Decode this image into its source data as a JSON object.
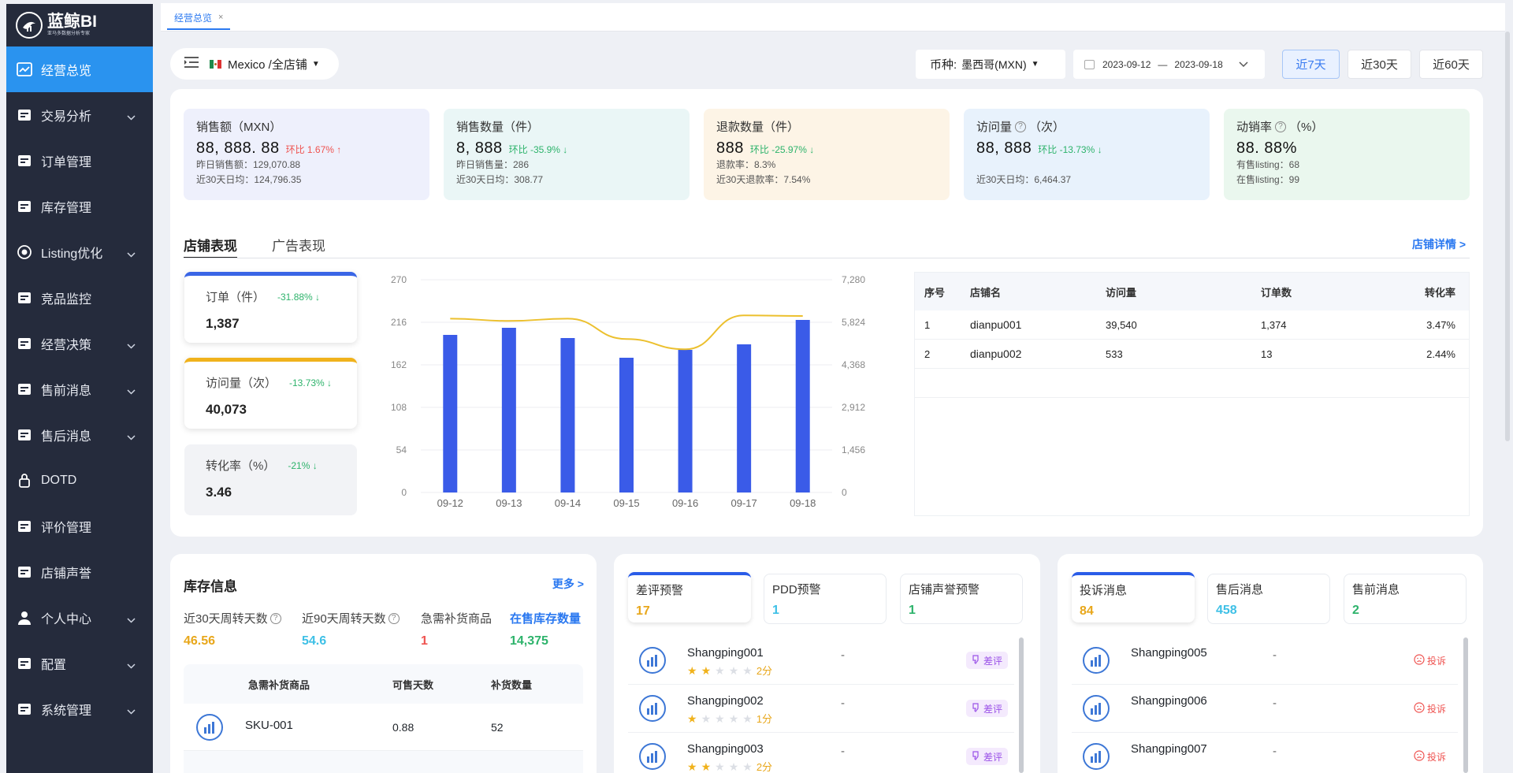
{
  "sidebar": {
    "logo_title": "蓝鲸BI",
    "logo_subtitle": "亚马多数据分析专家",
    "items": [
      {
        "label": "经营总览",
        "icon": "trend-chart-icon",
        "caret": false
      },
      {
        "label": "交易分析",
        "icon": "calendar-chart-icon",
        "caret": true
      },
      {
        "label": "订单管理",
        "icon": "order-icon",
        "caret": false
      },
      {
        "label": "库存管理",
        "icon": "inventory-icon",
        "caret": false
      },
      {
        "label": "Listing优化",
        "icon": "target-icon",
        "caret": true
      },
      {
        "label": "竞品监控",
        "icon": "lock-monitor-icon",
        "caret": false
      },
      {
        "label": "经营决策",
        "icon": "decision-icon",
        "caret": true
      },
      {
        "label": "售前消息",
        "icon": "message-icon",
        "caret": true
      },
      {
        "label": "售后消息",
        "icon": "after-sale-icon",
        "caret": true
      },
      {
        "label": "DOTD",
        "icon": "lock-icon",
        "caret": false
      },
      {
        "label": "评价管理",
        "icon": "review-icon",
        "caret": false
      },
      {
        "label": "店铺声誉",
        "icon": "reputation-icon",
        "caret": false
      },
      {
        "label": "个人中心",
        "icon": "user-icon",
        "caret": true
      },
      {
        "label": "配置",
        "icon": "config-icon",
        "caret": true
      },
      {
        "label": "系统管理",
        "icon": "system-icon",
        "caret": true
      }
    ]
  },
  "tabs": {
    "active_label": "经营总览",
    "close": "×"
  },
  "toolbar": {
    "store_selector": "Mexico /全店铺",
    "currency_label": "币种:",
    "currency_value": "墨西哥(MXN)",
    "date_start": "2023-09-12",
    "date_sep": "—",
    "date_end": "2023-09-18",
    "ranges": [
      "近7天",
      "近30天",
      "近60天"
    ]
  },
  "kpis": [
    {
      "title": "销售额（MXN）",
      "value": "88, 888. 88",
      "change": "环比 1.67% ↑",
      "trend": "up",
      "lines": [
        "昨日销售额：129,070.88",
        "近30天日均：124,796.35"
      ],
      "bg": "#eef0fc"
    },
    {
      "title": "销售数量（件）",
      "value": "8, 888",
      "change": "环比 -35.9% ↓",
      "trend": "down",
      "lines": [
        "昨日销售量：286",
        "近30天日均：308.77"
      ],
      "bg": "#eaf6f6"
    },
    {
      "title": "退款数量（件）",
      "value": "888",
      "change": "环比 -25.97% ↓",
      "trend": "down",
      "lines": [
        "退款率：8.3%",
        "近30天退款率：7.54%"
      ],
      "bg": "#fdf4e6"
    },
    {
      "title": "访问量",
      "unit": "（次）",
      "value": "88, 888",
      "change": "环比 -13.73% ↓",
      "trend": "down",
      "lines": [
        "",
        "近30天日均：6,464.37"
      ],
      "bg": "#e8f2fc"
    },
    {
      "title": "动销率",
      "unit": "（%）",
      "value": "88. 88%",
      "change": "",
      "trend": "",
      "lines": [
        "有售listing：68",
        "在售listing：99"
      ],
      "bg": "#eaf7ee"
    }
  ],
  "store_section": {
    "tabs": [
      "店铺表现",
      "广告表现"
    ],
    "detail_link": "店铺详情 >",
    "metrics": [
      {
        "label": "订单（件）",
        "change": "-31.88% ↓",
        "value": "1,387",
        "accent": "#3a66e6"
      },
      {
        "label": "访问量（次）",
        "change": "-13.73% ↓",
        "value": "40,073",
        "accent": "#f0b21c"
      },
      {
        "label": "转化率（%）",
        "change": "-21% ↓",
        "value": "3.46",
        "accent": ""
      }
    ],
    "table": {
      "headers": [
        "序号",
        "店铺名",
        "访问量",
        "订单数",
        "转化率"
      ],
      "rows": [
        [
          "1",
          "dianpu001",
          "39,540",
          "1,374",
          "3.47%"
        ],
        [
          "2",
          "dianpu002",
          "533",
          "13",
          "2.44%"
        ]
      ]
    }
  },
  "chart_data": {
    "type": "bar",
    "categories": [
      "09-12",
      "09-13",
      "09-14",
      "09-15",
      "09-16",
      "09-17",
      "09-18"
    ],
    "series": [
      {
        "type": "bar",
        "axis": "left",
        "color": "#3a5be8",
        "values": [
          200,
          209,
          196,
          171,
          181,
          188,
          219
        ]
      },
      {
        "type": "line",
        "axis": "right",
        "color": "#ecc02e",
        "values": [
          5950,
          5870,
          5950,
          5250,
          4900,
          6060,
          6040
        ]
      }
    ],
    "ylim": [
      0,
      270
    ],
    "yticks": [
      "270",
      "216",
      "162",
      "108",
      "54",
      "0"
    ],
    "y2lim": [
      0,
      7280
    ],
    "y2ticks": [
      "7,280",
      "5,824",
      "4,368",
      "2,912",
      "1,456",
      "0"
    ]
  },
  "inventory": {
    "title": "库存信息",
    "more": "更多 >",
    "stats": [
      {
        "label": "近30天周转天数",
        "value": "46.56",
        "color": "#e8a71b",
        "help": true
      },
      {
        "label": "近90天周转天数",
        "value": "54.6",
        "color": "#3ec0e6",
        "help": true
      },
      {
        "label": "急需补货商品",
        "value": "1",
        "color": "#ef5350",
        "help": false
      },
      {
        "label": "在售库存数量",
        "value": "14,375",
        "color": "#2db36b",
        "help": false,
        "highlight": true
      }
    ],
    "table_headers": [
      "急需补货商品",
      "可售天数",
      "补货数量"
    ],
    "rows": [
      [
        "SKU-001",
        "0.88",
        "52"
      ]
    ]
  },
  "alerts": {
    "cards": [
      {
        "label": "差评预警",
        "value": "17",
        "color": "#e8a71b"
      },
      {
        "label": "PDD预警",
        "value": "1",
        "color": "#3ec0e6"
      },
      {
        "label": "店铺声誉预警",
        "value": "1",
        "color": "#2db36b"
      }
    ],
    "tag": "差评",
    "items": [
      {
        "name": "Shangping001",
        "stars": 2,
        "score": "2分",
        "dash": "-"
      },
      {
        "name": "Shangping002",
        "stars": 1,
        "score": "1分",
        "dash": "-"
      },
      {
        "name": "Shangping003",
        "stars": 2,
        "score": "2分",
        "dash": "-"
      }
    ]
  },
  "messages": {
    "cards": [
      {
        "label": "投诉消息",
        "value": "84",
        "color": "#e8a71b"
      },
      {
        "label": "售后消息",
        "value": "458",
        "color": "#3ec0e6"
      },
      {
        "label": "售前消息",
        "value": "2",
        "color": "#2db36b"
      }
    ],
    "tag": "投诉",
    "items": [
      {
        "name": "Shangping005",
        "dash": "-"
      },
      {
        "name": "Shangping006",
        "dash": "-"
      },
      {
        "name": "Shangping007",
        "dash": "-"
      }
    ]
  }
}
